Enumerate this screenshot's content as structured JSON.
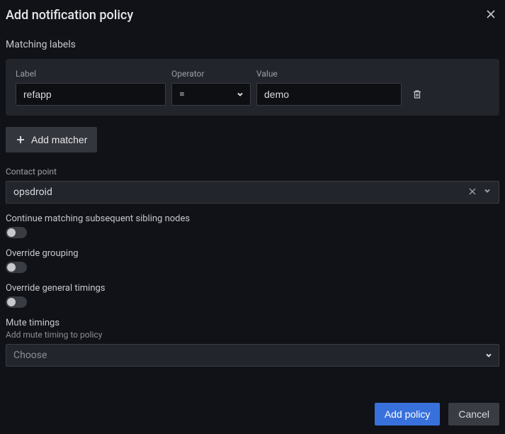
{
  "header": {
    "title": "Add notification policy"
  },
  "matching": {
    "heading": "Matching labels",
    "labels": {
      "label": "Label",
      "operator": "Operator",
      "value": "Value"
    },
    "row": {
      "label_value": "refapp",
      "operator_value": "=",
      "value_value": "demo"
    },
    "add_matcher": "Add matcher"
  },
  "contact": {
    "label": "Contact point",
    "value": "opsdroid"
  },
  "toggles": {
    "continue": "Continue matching subsequent sibling nodes",
    "override_grouping": "Override grouping",
    "override_timings": "Override general timings"
  },
  "mute": {
    "title": "Mute timings",
    "subtitle": "Add mute timing to policy",
    "placeholder": "Choose"
  },
  "footer": {
    "primary": "Add policy",
    "secondary": "Cancel"
  }
}
